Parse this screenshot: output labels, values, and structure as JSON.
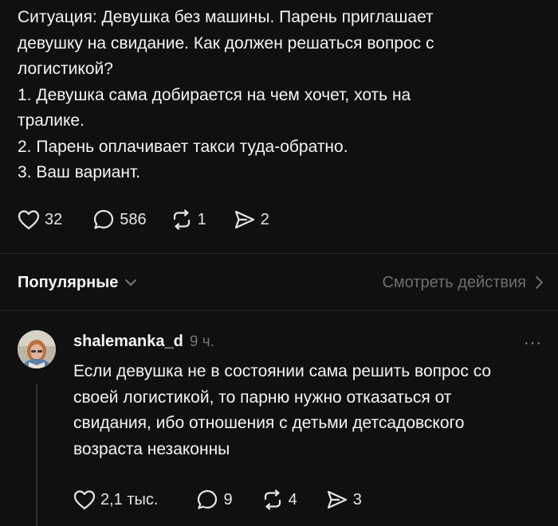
{
  "post": {
    "lines": [
      "Ситуация: Девушка без машины. Парень приглашает",
      "девушку на свидание. Как должен решаться вопрос с",
      "логистикой?",
      "1. Девушка сама добирается на чем хочет, хоть на",
      "тралике.",
      "2. Парень оплачивает такси туда-обратно.",
      "3. Ваш вариант."
    ],
    "likes": "32",
    "comments": "586",
    "reposts": "1",
    "shares": "2"
  },
  "sort": {
    "label": "Популярные",
    "view_activity": "Смотреть действия"
  },
  "reply": {
    "username": "shalemanka_d",
    "time": "9 ч.",
    "more": "···",
    "lines": [
      "Если девушка не в состоянии сама решить вопрос со",
      "своей логистикой, то парню нужно отказаться от",
      "свидания, ибо отношения с детьми детсадовского",
      "возраста незаконны"
    ],
    "likes": "2,1 тыс.",
    "comments": "9",
    "reposts": "4",
    "shares": "3"
  },
  "icons": {
    "like": "heart-icon",
    "comment": "comment-bubble-icon",
    "repost": "repost-icon",
    "share": "send-icon",
    "chevron_down": "chevron-down-icon",
    "chevron_right": "chevron-right-icon"
  },
  "colors": {
    "background": "#101010",
    "text": "#f3f5f7",
    "secondary": "#777777"
  }
}
